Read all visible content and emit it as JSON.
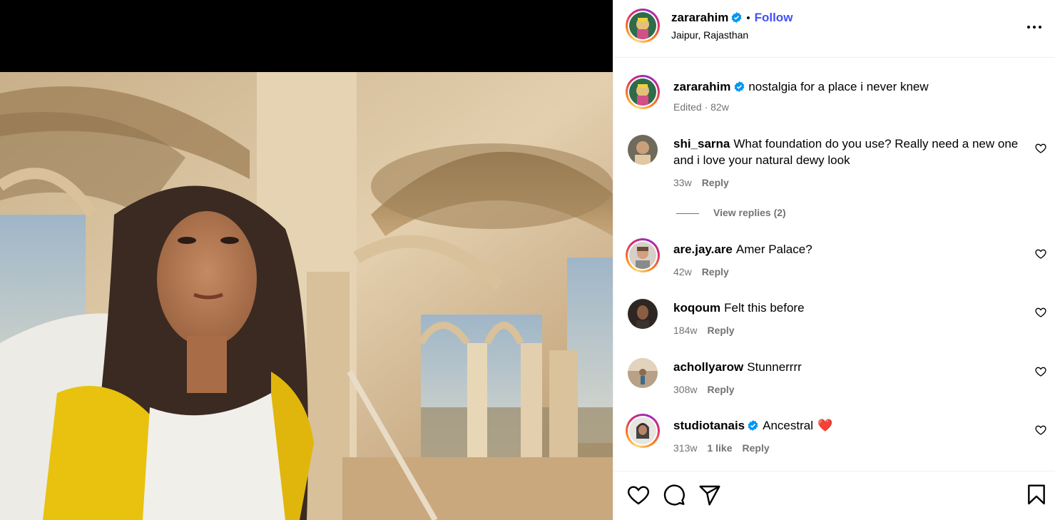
{
  "post": {
    "author": "zararahim",
    "follow_label": "Follow",
    "separator": "•",
    "location": "Jaipur, Rajasthan",
    "more_icon": "more-horizontal-icon",
    "caption": {
      "username": "zararahim",
      "text": "nostalgia for a place i never knew",
      "meta": "Edited · 82w"
    }
  },
  "comments": [
    {
      "username": "shi_sarna",
      "text": "What foundation do you use? Really need a new one and i love your natural dewy look",
      "time": "33w",
      "reply_label": "Reply",
      "view_replies": "View replies (2)"
    },
    {
      "username": "are.jay.are",
      "text": "Amer Palace?",
      "time": "42w",
      "reply_label": "Reply"
    },
    {
      "username": "koqoum",
      "text": "Felt this before",
      "time": "184w",
      "reply_label": "Reply"
    },
    {
      "username": "achollyarow",
      "text": "Stunnerrrr",
      "time": "308w",
      "reply_label": "Reply"
    },
    {
      "username": "studiotanais",
      "text": "Ancestral",
      "time": "313w",
      "likes": "1 like",
      "reply_label": "Reply",
      "emoji": "❤️"
    }
  ],
  "action_icons": [
    "heart-icon",
    "comment-icon",
    "share-icon",
    "bookmark-icon"
  ],
  "colors": {
    "follow": "#4150f7",
    "verified": "#0095f6",
    "muted": "#737373",
    "heart_emoji": "#ed1c24"
  }
}
